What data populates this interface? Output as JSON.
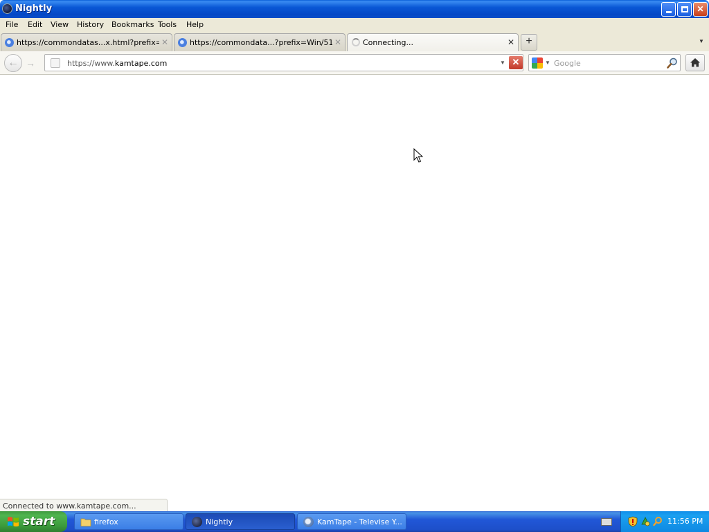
{
  "window": {
    "title": "Nightly",
    "icons": {
      "app": "nightly-globe-icon",
      "minimize": "minimize-icon",
      "maximize": "restore-icon",
      "close": "close-icon"
    }
  },
  "menu": {
    "items": [
      "File",
      "Edit",
      "View",
      "History",
      "Bookmarks",
      "Tools",
      "Help"
    ]
  },
  "tabs": [
    {
      "label": "https://commondatas...x.html?prefix=Win/",
      "state": "loaded",
      "icon": "globe-favicon-icon"
    },
    {
      "label": "https://commondata...?prefix=Win/51594/",
      "state": "loaded",
      "icon": "globe-favicon-icon"
    },
    {
      "label": "Connecting...",
      "state": "loading",
      "icon": "loading-spinner-icon",
      "active": true
    }
  ],
  "navbar": {
    "url_prefix": "https://www.",
    "url_host": "kamtape.com",
    "search_placeholder": "Google",
    "search_engine_icon": "google-icon"
  },
  "status": {
    "text": "Connected to www.kamtape.com..."
  },
  "taskbar": {
    "start_label": "start",
    "buttons": [
      {
        "label": "firefox",
        "icon": "folder-icon",
        "active": false
      },
      {
        "label": "Nightly",
        "icon": "nightly-globe-icon",
        "active": true
      },
      {
        "label": "KamTape - Televise Y...",
        "icon": "kamtape-icon",
        "active": false
      }
    ],
    "clock": "11:56 PM"
  },
  "colors": {
    "titlebar": "#0a58d6",
    "taskbar": "#2157d7",
    "start_button": "#3c9b3c",
    "tray": "#0f8ee8",
    "stop_button": "#c2392a"
  }
}
